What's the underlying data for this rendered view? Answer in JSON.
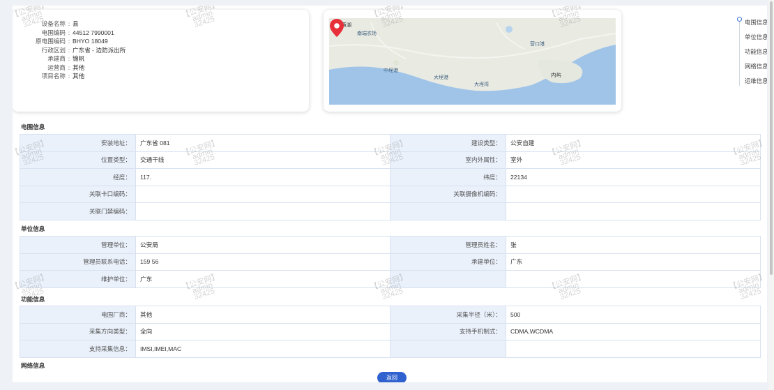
{
  "summary": {
    "rows": [
      {
        "label": "设备名称",
        "sep": ":",
        "value": "县"
      },
      {
        "label": "电围编码",
        "sep": ":",
        "value": "44512 7990001"
      },
      {
        "label": "原电围编码",
        "sep": ":",
        "value": "BHYO 18049"
      },
      {
        "label": "行政区划",
        "sep": ":",
        "value": "广东省 - 边防派出所"
      },
      {
        "label": "承建商",
        "sep": ":",
        "value": "锦帆"
      },
      {
        "label": "运营商",
        "sep": ":",
        "value": "其他"
      },
      {
        "label": "项目名称",
        "sep": ":",
        "value": "其他"
      }
    ]
  },
  "map": {
    "labels": [
      "界引黄湖",
      "南端农场",
      "营口港",
      "内屿",
      "大埕湾",
      "大埕港",
      "中埕港"
    ]
  },
  "anchor_nav": {
    "items": [
      "电围信息",
      "单位信息",
      "功能信息",
      "网络信息",
      "运维信息"
    ]
  },
  "sections": {
    "fence": {
      "title": "电围信息",
      "rows": [
        [
          {
            "label": "安装地址",
            "value": "广东省 081"
          },
          {
            "label": "建设类型",
            "value": "公安自建"
          }
        ],
        [
          {
            "label": "位置类型",
            "value": "交通干线"
          },
          {
            "label": "室内外属性",
            "value": "室外"
          }
        ],
        [
          {
            "label": "经度",
            "value": "117."
          },
          {
            "label": "纬度",
            "value": "22134"
          }
        ],
        [
          {
            "label": "关联卡口编码",
            "value": ""
          },
          {
            "label": "关联摄像机编码",
            "value": ""
          }
        ],
        [
          {
            "label": "关联门禁编码",
            "value": ""
          },
          {
            "label": "",
            "value": ""
          }
        ]
      ]
    },
    "unit": {
      "title": "单位信息",
      "rows": [
        [
          {
            "label": "管理单位",
            "value": "公安局"
          },
          {
            "label": "管理员姓名",
            "value": "张"
          }
        ],
        [
          {
            "label": "管理员联系电话",
            "value": "159 56"
          },
          {
            "label": "承建单位",
            "value": "广东"
          }
        ],
        [
          {
            "label": "维护单位",
            "value": "广东"
          },
          {
            "label": "",
            "value": ""
          }
        ]
      ]
    },
    "function": {
      "title": "功能信息",
      "rows": [
        [
          {
            "label": "电围厂商",
            "value": "其他"
          },
          {
            "label": "采集半径（米）",
            "value": "500"
          }
        ],
        [
          {
            "label": "采集方向类型",
            "value": "全向"
          },
          {
            "label": "支持手机制式",
            "value": "CDMA,WCDMA"
          }
        ],
        [
          {
            "label": "支持采集信息",
            "value": "IMSI,IMEI,MAC"
          },
          {
            "label": "",
            "value": ""
          }
        ]
      ]
    },
    "network": {
      "title": "网络信息"
    }
  },
  "watermark": {
    "line1": "【公安网】",
    "line2": "admin",
    "line3": "32425"
  },
  "back_button": "返回",
  "colors": {
    "accent": "#2f62cf",
    "label_bg": "#eaf1fb",
    "pin": "#e8303a",
    "sea": "#9fc4e8",
    "land": "#e9ebe3"
  }
}
